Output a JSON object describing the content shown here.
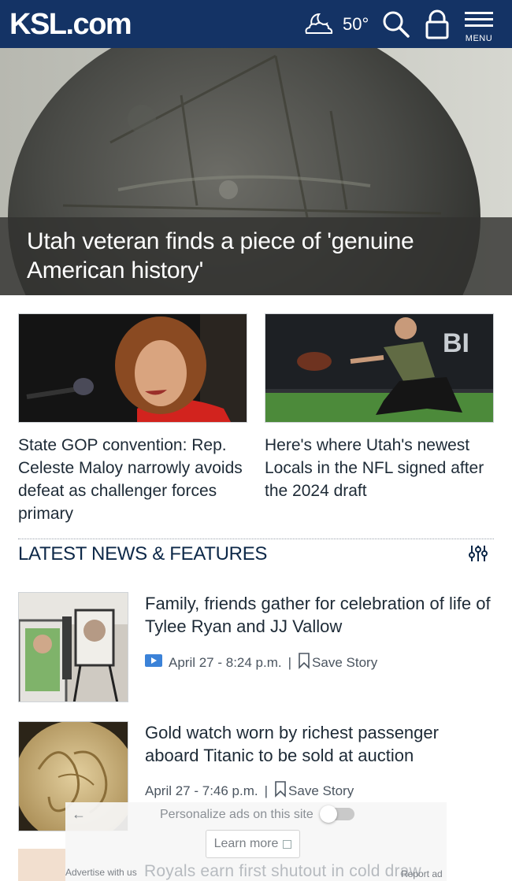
{
  "header": {
    "logo": "KSL.com",
    "temperature": "50°",
    "menu_label": "MENU",
    "weather_icon": "moon-cloud-icon"
  },
  "hero": {
    "title": "Utah veteran finds a piece of 'genuine American history'"
  },
  "cards": [
    {
      "title": "State GOP convention: Rep. Celeste Maloy narrowly avoids defeat as challenger forces primary"
    },
    {
      "title": "Here's where Utah's newest Locals in the NFL signed after the 2024 draft"
    }
  ],
  "section": {
    "title": "LATEST NEWS & FEATURES"
  },
  "stories": [
    {
      "title": "Family, friends gather for celebration of life of Tylee Ryan and JJ Vallow",
      "date": "April 27 - 8:24 p.m.",
      "separator": "|",
      "save_label": "Save Story",
      "has_video": true
    },
    {
      "title": "Gold watch worn by richest passenger aboard Titanic to be sold at auction",
      "date": "April 27 - 7:46 p.m.",
      "separator": "|",
      "save_label": "Save Story",
      "has_video": false
    }
  ],
  "ad": {
    "back_arrow": "←",
    "personalize": "Personalize ads on this site",
    "learn_more": "Learn more",
    "partial_headline": "Royals earn first shutout in cold draw",
    "advertise": "Advertise with us",
    "report": "Report ad"
  },
  "colors": {
    "header_bg": "#143365",
    "text": "#1d2a36",
    "video_badge": "#3b82d8"
  }
}
